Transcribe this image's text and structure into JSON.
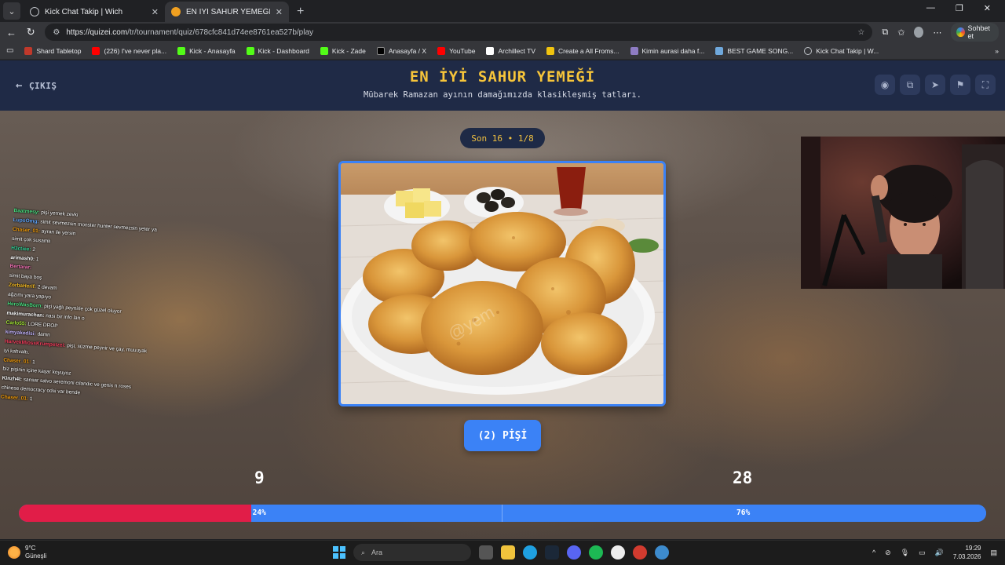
{
  "browser": {
    "tabs": [
      {
        "title": "Kick Chat Takip | Wich",
        "active": false
      },
      {
        "title": "EN İYİ SAHUR YEMEĞİ - Tier List, K",
        "active": true
      }
    ],
    "url": {
      "host": "https://quizei.com",
      "path": "/tr/tournament/quiz/678cfc841d74ee8761ea527b/play"
    },
    "sohbet_label": "Sohbet et",
    "bookmarks": [
      "Shard Tabletop",
      "(226) I've never pla...",
      "Kick - Anasayfa",
      "Kick - Dashboard",
      "Kick - Zade",
      "Anasayfa / X",
      "YouTube",
      "Archillect TV",
      "Create a All Froms...",
      "Kimin aurasi daha f...",
      "BEST GAME SONG...",
      "Kick Chat Takip | W..."
    ]
  },
  "quiz": {
    "exit_label": "ÇIKIŞ",
    "title": "EN İYİ SAHUR YEMEĞİ",
    "subtitle": "Mübarek Ramazan ayının damağımızda klasikleşmiş tatları.",
    "round": "Son 16 • 1/8",
    "choice_label": "(2) PİŞİ",
    "votes_left": "9",
    "votes_right": "28",
    "percent_left": "24%",
    "percent_right": "76%",
    "left_fraction": 0.24,
    "photo_watermark": "@yem"
  },
  "chat": [
    {
      "user": "Baatmesy:",
      "text": "pişi yemek zevki",
      "color": "#4ade80"
    },
    {
      "user": "LupoOmg:",
      "text": "simit sevmezsin monster hunter sevmezsin yeter ya",
      "color": "#60a5fa"
    },
    {
      "user": "Chaser_01:",
      "text": "ayran ile yersin",
      "color": "#f59e0b"
    },
    {
      "user": "",
      "text": "simit çok susamlı",
      "color": "#a78bfa"
    },
    {
      "user": "H3ctiee:",
      "text": "2",
      "color": "#34d399"
    },
    {
      "user": "arimash0:",
      "text": "1",
      "color": "#ffffff"
    },
    {
      "user": "Bertarar:",
      "text": "",
      "color": "#f472b6"
    },
    {
      "user": "",
      "text": "simit baya boş",
      "color": "#f87171"
    },
    {
      "user": "ZorbaHerif:",
      "text": "2 devam",
      "color": "#fbbf24"
    },
    {
      "user": "",
      "text": "ağzımı yara yapıyo",
      "color": "#60a5fa"
    },
    {
      "user": "HeroWasBorn:",
      "text": "pişi yağlı peynirle çok güzel oluyor",
      "color": "#4ade80"
    },
    {
      "user": "makimurachan:",
      "text": "nası bir info lan o",
      "color": "#ffffff"
    },
    {
      "user": "Carlo55:",
      "text": "LORE DROP",
      "color": "#a3e635"
    },
    {
      "user": "kimyakedisi:",
      "text": "damn",
      "color": "#c4b5fd"
    },
    {
      "user": "",
      "text": "",
      "color": "#f87171"
    },
    {
      "user": "HarvekMiossKrumpetzei:",
      "text": "pişi, süzme peynir ve çay, muuuyak",
      "color": "#f43f5e"
    },
    {
      "user": "",
      "text": "iyi kahvaltı.",
      "color": "#ffffff"
    },
    {
      "user": "Chaser_01:",
      "text": "1",
      "color": "#f59e0b"
    },
    {
      "user": "",
      "text": "biz pişinin içine kaşar koyuyoz",
      "color": "#60a5fa"
    },
    {
      "user": "Kinzh4l:",
      "text": "sansar salvo seremoni cilandic ve genis n roses",
      "color": "#ffffff"
    },
    {
      "user": "",
      "text": "chinese democracy odsi var bende",
      "color": "#ffffff"
    },
    {
      "user": "Chaser_01:",
      "text": "1",
      "color": "#f59e0b"
    }
  ],
  "taskbar": {
    "weather_temp": "9°C",
    "weather_desc": "Güneşli",
    "search_placeholder": "Ara",
    "time": "19:29",
    "date": "7.03.2026"
  }
}
